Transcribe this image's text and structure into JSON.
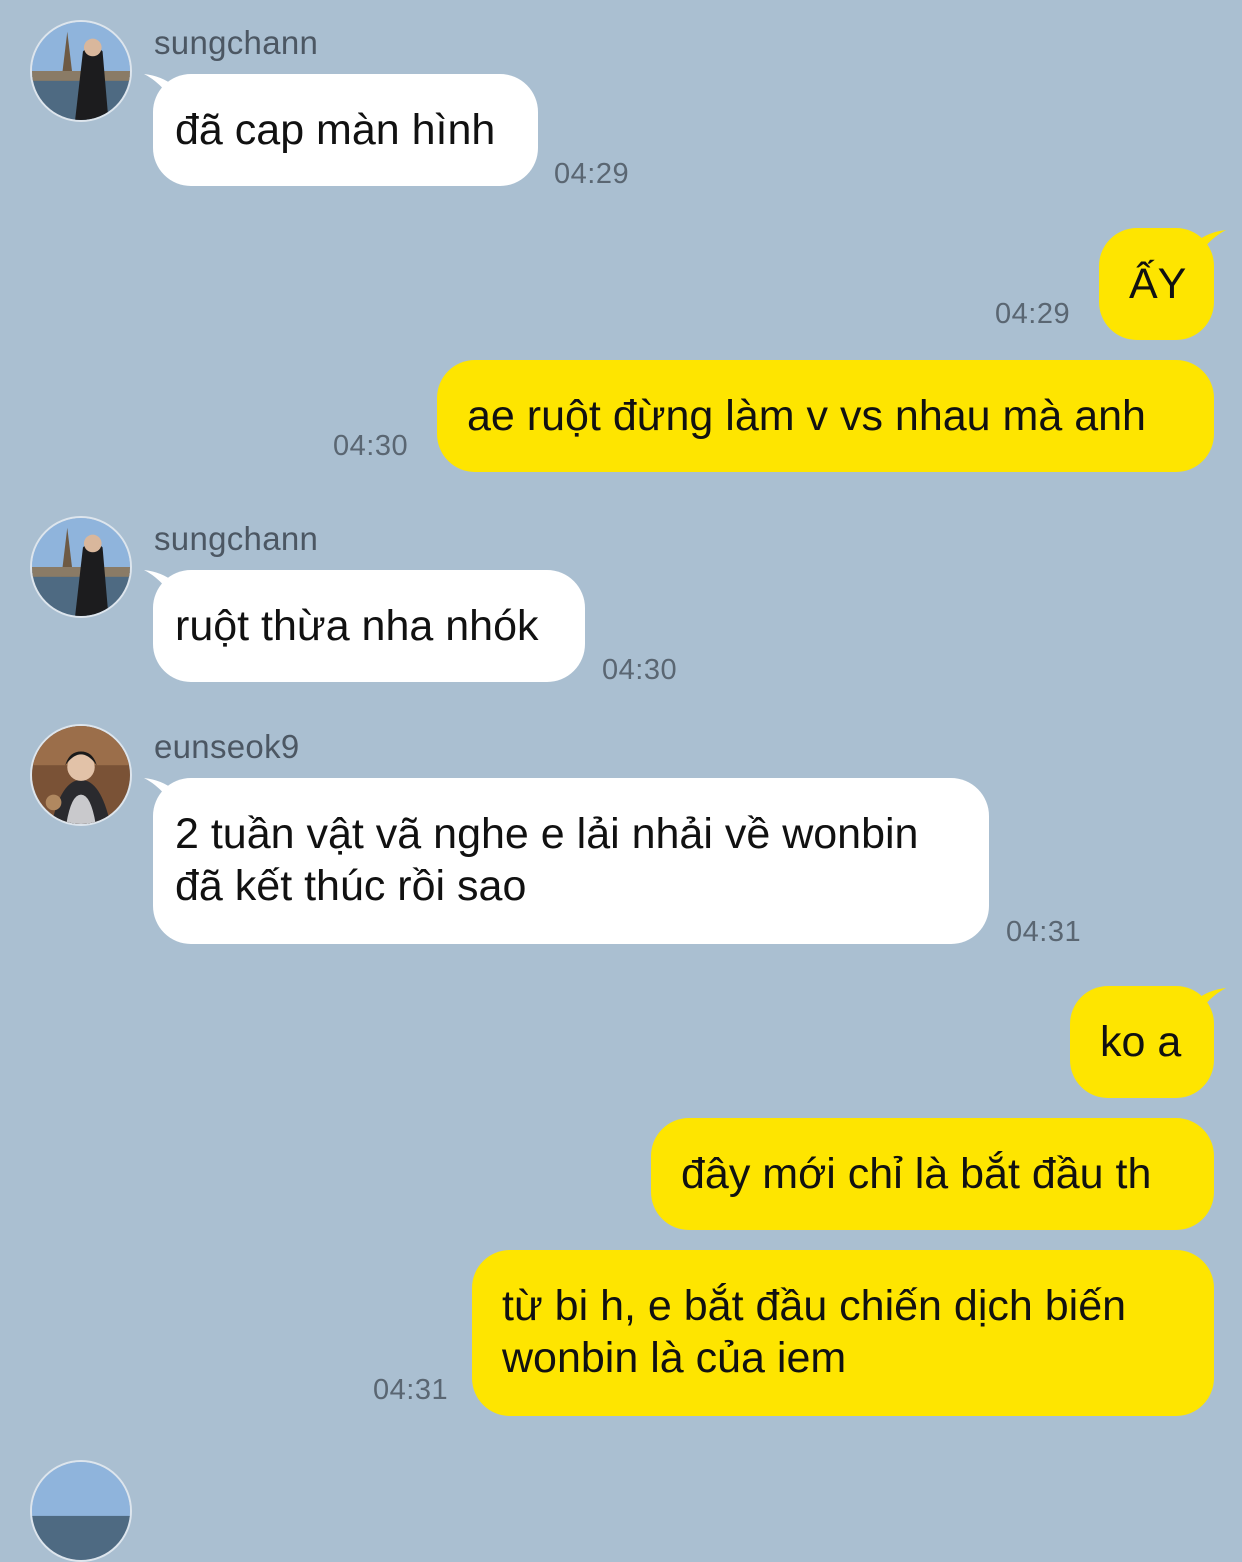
{
  "colors": {
    "background": "#aabfd1",
    "incoming_bubble": "#ffffff",
    "outgoing_bubble": "#fee500",
    "sender_text": "#4c5763",
    "time_text": "#5a6672"
  },
  "messages": [
    {
      "direction": "incoming",
      "sender": "sungchann",
      "avatar": "sungchann-avatar",
      "text": "đã cap màn hình",
      "time": "04:29"
    },
    {
      "direction": "outgoing",
      "text": "ẤY",
      "time": "04:29"
    },
    {
      "direction": "outgoing",
      "text": "ae ruột đừng làm v vs nhau mà anh",
      "time": "04:30"
    },
    {
      "direction": "incoming",
      "sender": "sungchann",
      "avatar": "sungchann-avatar",
      "text": "ruột thừa nha nhók",
      "time": "04:30"
    },
    {
      "direction": "incoming",
      "sender": "eunseok9",
      "avatar": "eunseok9-avatar",
      "text": "2 tuần vật vã nghe e lải nhải về wonbin đã kết thúc rồi sao",
      "time": "04:31"
    },
    {
      "direction": "outgoing",
      "text": "ko a",
      "time": ""
    },
    {
      "direction": "outgoing",
      "text": "đây mới chỉ là bắt đầu th",
      "time": ""
    },
    {
      "direction": "outgoing",
      "text": "từ bi h, e bắt đầu chiến dịch biến wonbin là của iem",
      "time": "04:31"
    }
  ]
}
